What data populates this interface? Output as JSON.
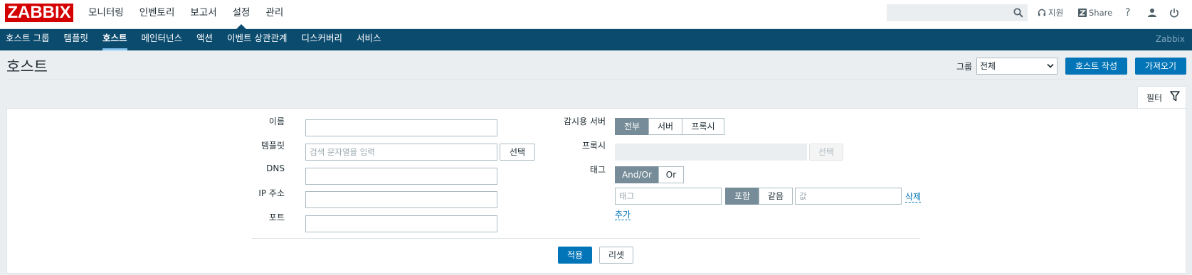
{
  "logo": "ZABBIX",
  "main_menu": [
    "모니터링",
    "인벤토리",
    "보고서",
    "설정",
    "관리"
  ],
  "main_menu_active": "설정",
  "top_icons": {
    "support_label": "지원",
    "share_label": "Share",
    "help_label": "?"
  },
  "sub_menu": [
    "호스트 그룹",
    "템플릿",
    "호스트",
    "메인터넌스",
    "액션",
    "이벤트 상관관계",
    "디스커버리",
    "서비스"
  ],
  "sub_menu_active": "호스트",
  "brand": "Zabbix",
  "page": {
    "title": "호스트",
    "group_label": "그룹",
    "group_value": "전체",
    "create_button": "호스트 작성",
    "import_button": "가져오기"
  },
  "filter": {
    "tab_label": "필터",
    "name_label": "이름",
    "name_value": "",
    "template_label": "템플릿",
    "template_placeholder": "검색 문자열을 입력",
    "select_label": "선택",
    "dns_label": "DNS",
    "ip_label": "IP 주소",
    "port_label": "포트",
    "monitored_by_label": "감시용 서버",
    "monitored_by_options": [
      "전부",
      "서버",
      "프록시"
    ],
    "monitored_by_selected": "전부",
    "proxy_label": "프록시",
    "proxy_select_label": "선택",
    "tags_label": "태그",
    "tag_ops": [
      "And/Or",
      "Or"
    ],
    "tag_ops_selected": "And/Or",
    "tag_placeholder": "태그",
    "tag_match": [
      "포함",
      "같음"
    ],
    "tag_match_selected": "포함",
    "value_placeholder": "값",
    "remove_link": "삭제",
    "add_link": "추가",
    "apply_button": "적용",
    "reset_button": "리셋"
  },
  "colors": {
    "logo_red": "#d40000",
    "nav_blue": "#0b4b6e",
    "button_blue": "#0275b8",
    "segment_selected": "#768d99"
  }
}
